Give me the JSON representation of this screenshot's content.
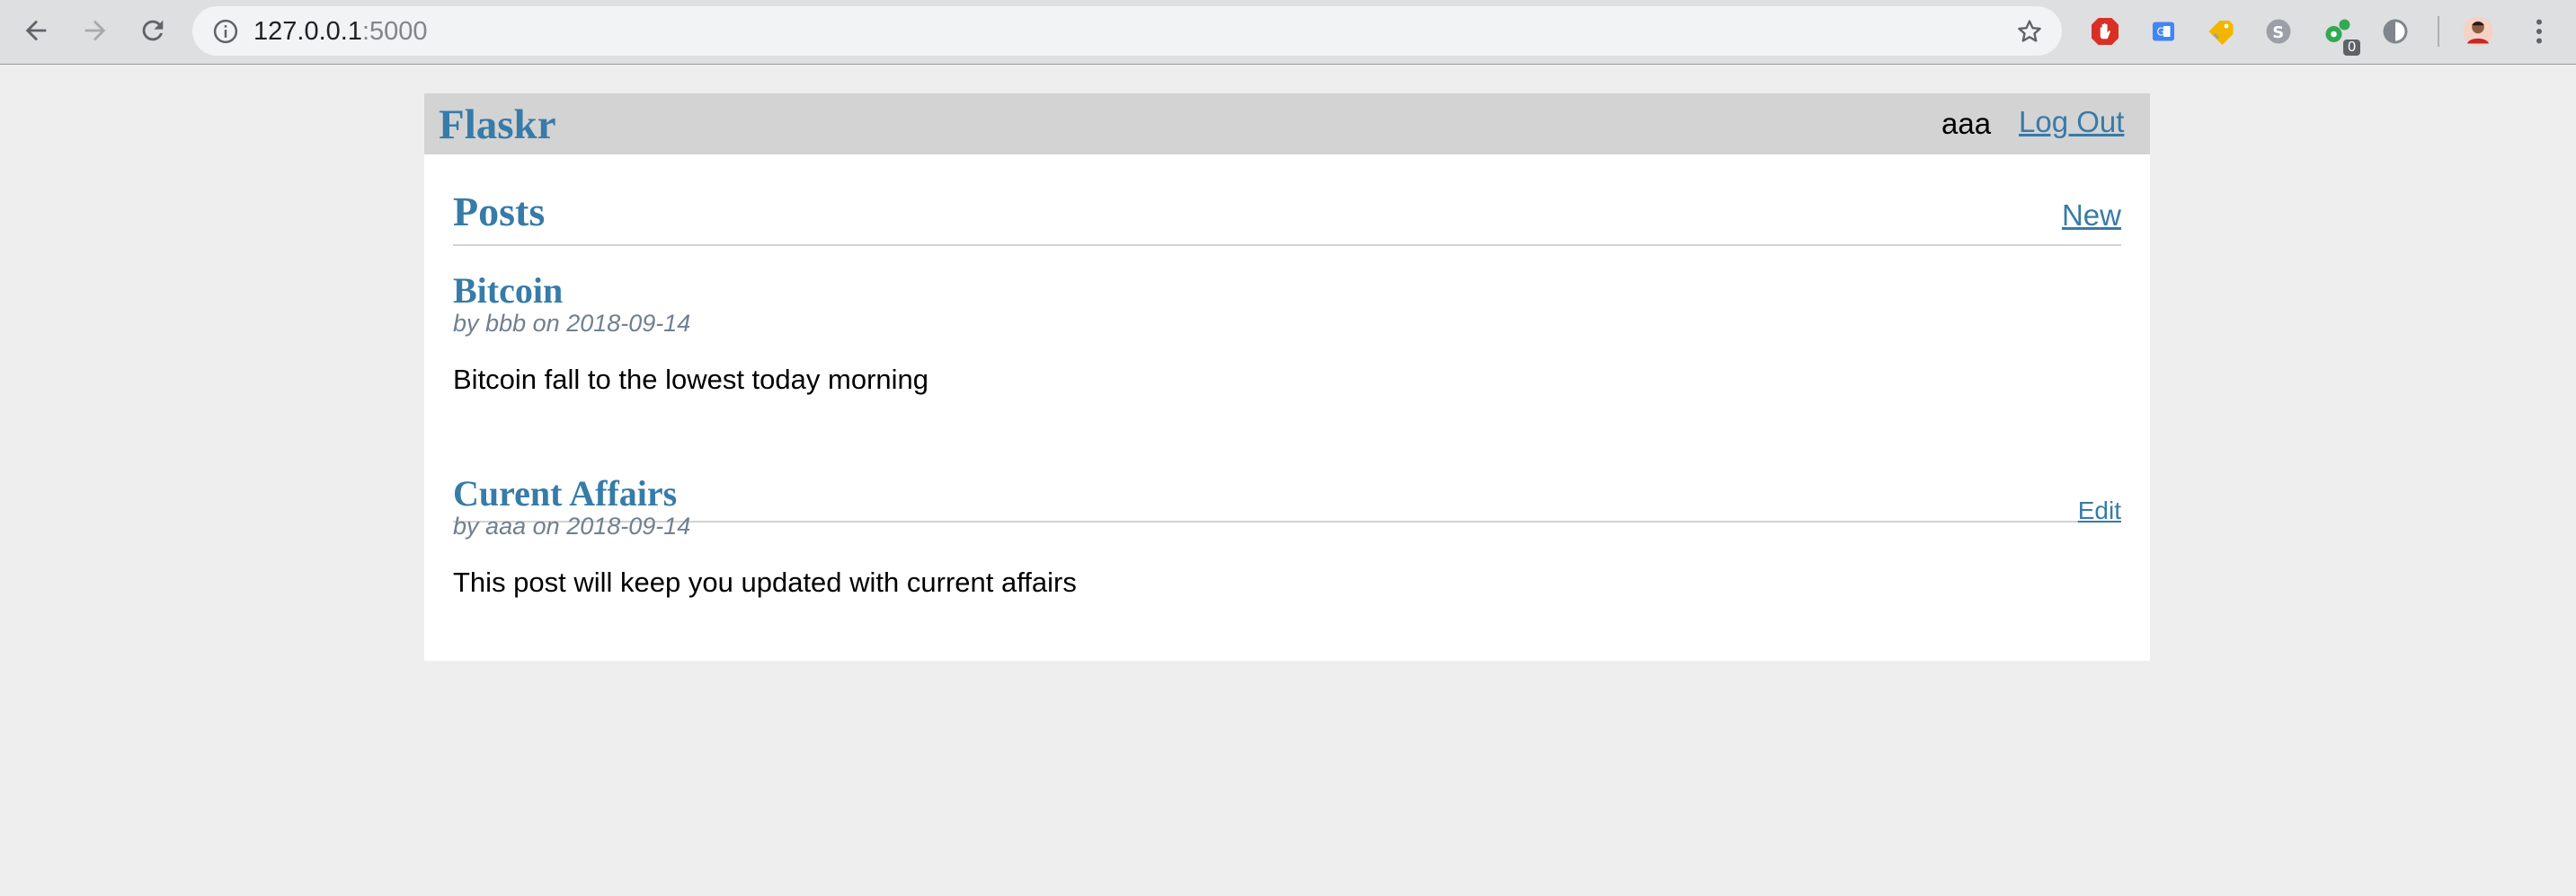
{
  "browser": {
    "url_host": "127.0.0.1",
    "url_port": ":5000",
    "extension_badge": "0"
  },
  "app": {
    "title": "Flaskr",
    "user": "aaa",
    "logout_label": "Log Out"
  },
  "posts_header": {
    "title": "Posts",
    "new_label": "New"
  },
  "posts": [
    {
      "title": "Bitcoin",
      "author": "bbb",
      "date": "2018-09-14",
      "body": "Bitcoin fall to the lowest today morning"
    },
    {
      "title": "Curent Affairs",
      "author": "aaa",
      "date": "2018-09-14",
      "body": "This post will keep you updated with current affairs",
      "edit_label": "Edit"
    }
  ],
  "meta_labels": {
    "by": "by",
    "on": "on"
  },
  "colors": {
    "link": "#377ba8",
    "nav_bg": "#d3d3d3",
    "meta": "#708090"
  }
}
